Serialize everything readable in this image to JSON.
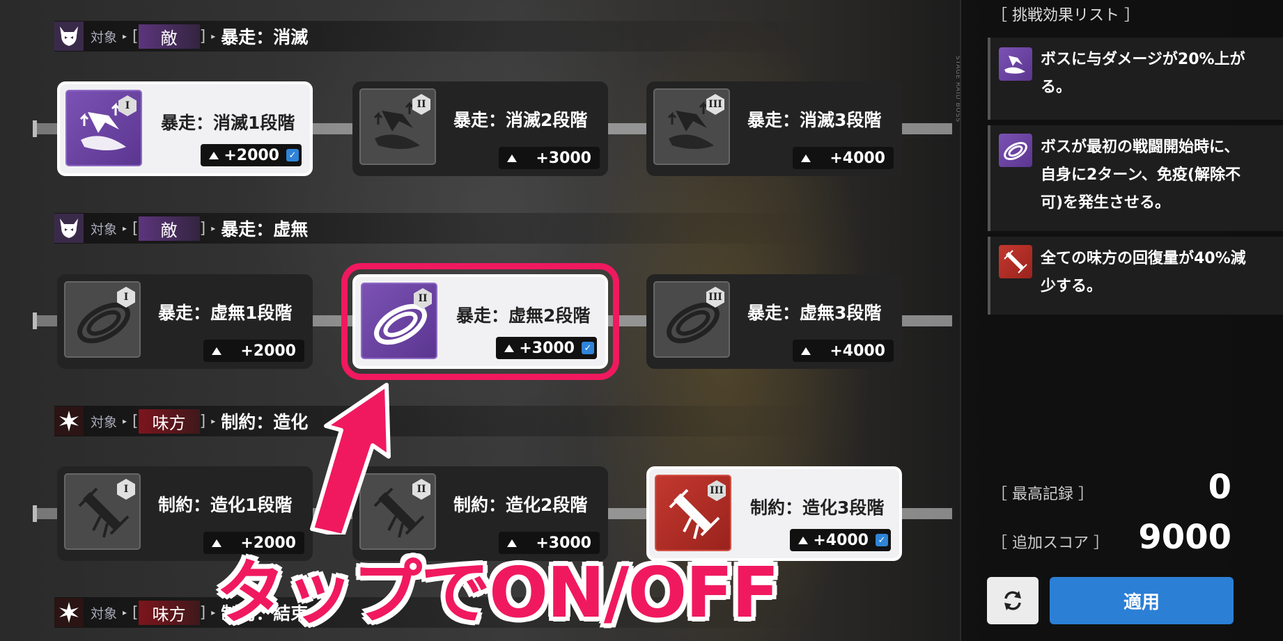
{
  "sections": [
    {
      "target_label": "対象",
      "tag": "敵",
      "name": "暴走：消滅",
      "icon": "demon-mask-icon",
      "type": "enemy"
    },
    {
      "target_label": "対象",
      "tag": "敵",
      "name": "暴走：虚無",
      "icon": "demon-mask-icon",
      "type": "enemy"
    },
    {
      "target_label": "対象",
      "tag": "味方",
      "name": "制約：造化",
      "icon": "starburst-icon",
      "type": "ally"
    },
    {
      "target_label": "対象",
      "tag": "味方",
      "name": "制約：結束",
      "icon": "starburst-icon",
      "type": "ally"
    }
  ],
  "rows": [
    [
      {
        "title": "暴走：消滅1段階",
        "score": "+2000",
        "rank": "I",
        "selected": true,
        "color": "purple",
        "icon": "sword-slash-icon"
      },
      {
        "title": "暴走：消滅2段階",
        "score": "+3000",
        "rank": "II",
        "selected": false,
        "color": "gray",
        "icon": "sword-slash-icon"
      },
      {
        "title": "暴走：消滅3段階",
        "score": "+4000",
        "rank": "III",
        "selected": false,
        "color": "gray",
        "icon": "sword-slash-icon"
      }
    ],
    [
      {
        "title": "暴走：虚無1段階",
        "score": "+2000",
        "rank": "I",
        "selected": false,
        "color": "gray",
        "icon": "vortex-icon"
      },
      {
        "title": "暴走：虚無2段階",
        "score": "+3000",
        "rank": "II",
        "selected": true,
        "color": "purple",
        "icon": "vortex-icon"
      },
      {
        "title": "暴走：虚無3段階",
        "score": "+4000",
        "rank": "III",
        "selected": false,
        "color": "gray",
        "icon": "vortex-icon"
      }
    ],
    [
      {
        "title": "制約：造化1段階",
        "score": "+2000",
        "rank": "I",
        "selected": false,
        "color": "gray",
        "icon": "broken-syringe-icon"
      },
      {
        "title": "制約：造化2段階",
        "score": "+3000",
        "rank": "II",
        "selected": false,
        "color": "gray",
        "icon": "broken-syringe-icon"
      },
      {
        "title": "制約：造化3段階",
        "score": "+4000",
        "rank": "III",
        "selected": true,
        "color": "red",
        "icon": "broken-syringe-icon"
      }
    ]
  ],
  "sidebar": {
    "title": "［ 挑戦効果リスト ］",
    "vertical_text": "STAGE RAID BOSS",
    "effects": [
      {
        "text": "ボスに与ダメージが20%上がる。",
        "color": "purple",
        "icon": "sword-slash-icon"
      },
      {
        "text": "ボスが最初の戦闘開始時に、自身に2ターン、免疫(解除不可)を発生させる。",
        "color": "purple",
        "icon": "vortex-icon"
      },
      {
        "text": "全ての味方の回復量が40%減少する。",
        "color": "red",
        "icon": "broken-syringe-icon"
      }
    ],
    "best_record_label": "［ 最高記録 ］",
    "best_record_value": "0",
    "bonus_score_label": "［ 追加スコア ］",
    "bonus_score_value": "9000",
    "reset_icon": "refresh-icon",
    "apply_label": "適用"
  },
  "annotation": {
    "text": "タップでON/OFF",
    "color": "#f0195f"
  },
  "colors": {
    "accent_pink": "#f0195f",
    "purple": "#6b45a3",
    "red": "#b12b24",
    "apply_blue": "#2b7fd5",
    "checkbox_blue": "#2f84d8"
  }
}
